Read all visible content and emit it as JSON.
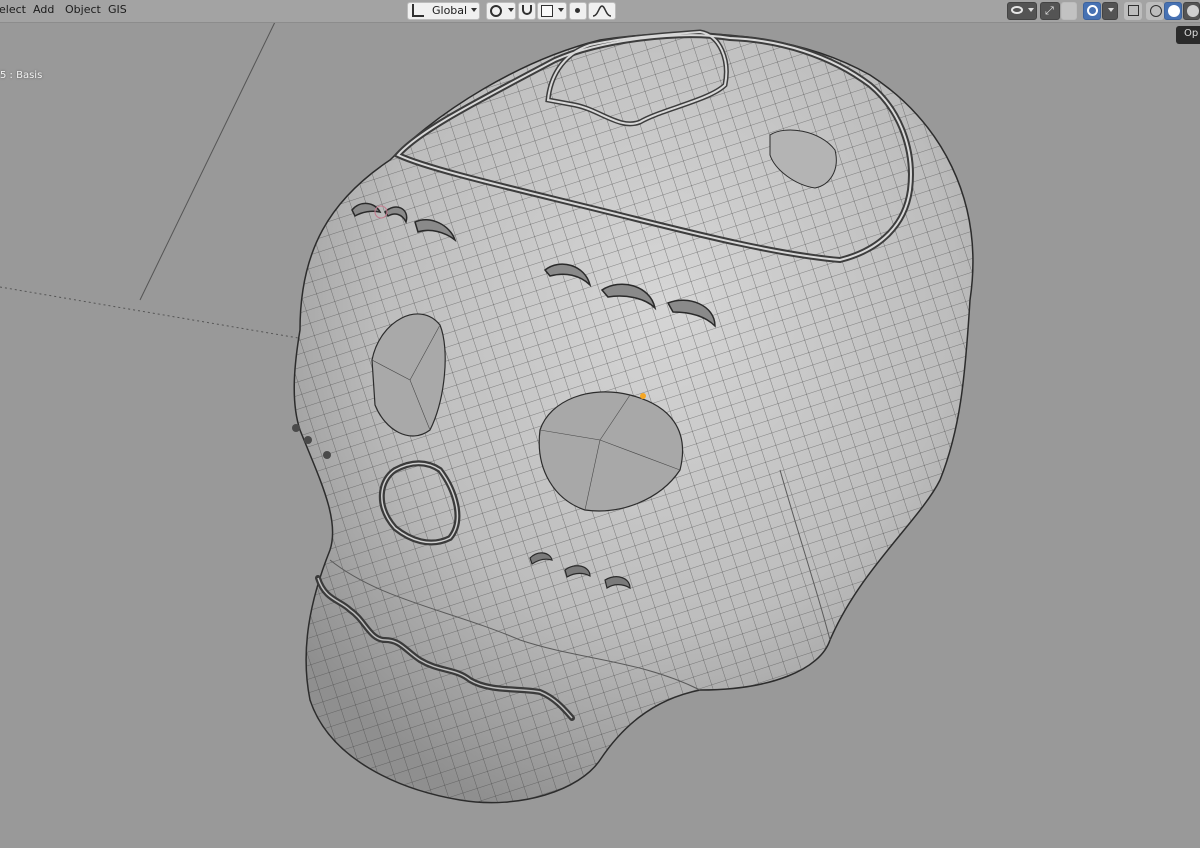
{
  "header": {
    "menus": [
      {
        "id": "select",
        "label": "elect"
      },
      {
        "id": "add",
        "label": "Add"
      },
      {
        "id": "object",
        "label": "Object"
      },
      {
        "id": "gis",
        "label": "GIS"
      }
    ],
    "transform_orientation": "Global",
    "pivot_icon": "pivot-icon",
    "snap_icon": "snap-magnet-icon",
    "proportional_icon": "proportional-edit-icon",
    "falloff_icon": "falloff-curve-icon"
  },
  "viewport": {
    "object_info": "5 : Basis",
    "tooltip": "Op",
    "shading_modes": [
      "wireframe",
      "solid",
      "material",
      "rendered"
    ],
    "active_shading": "solid"
  },
  "colors": {
    "header_bg": "#a3a3a3",
    "viewport_bg": "#999999",
    "mesh_fill": "#c4c4c4",
    "wire": "#3a3a3a",
    "accent": "#4772b3",
    "origin": "#f5a623"
  }
}
